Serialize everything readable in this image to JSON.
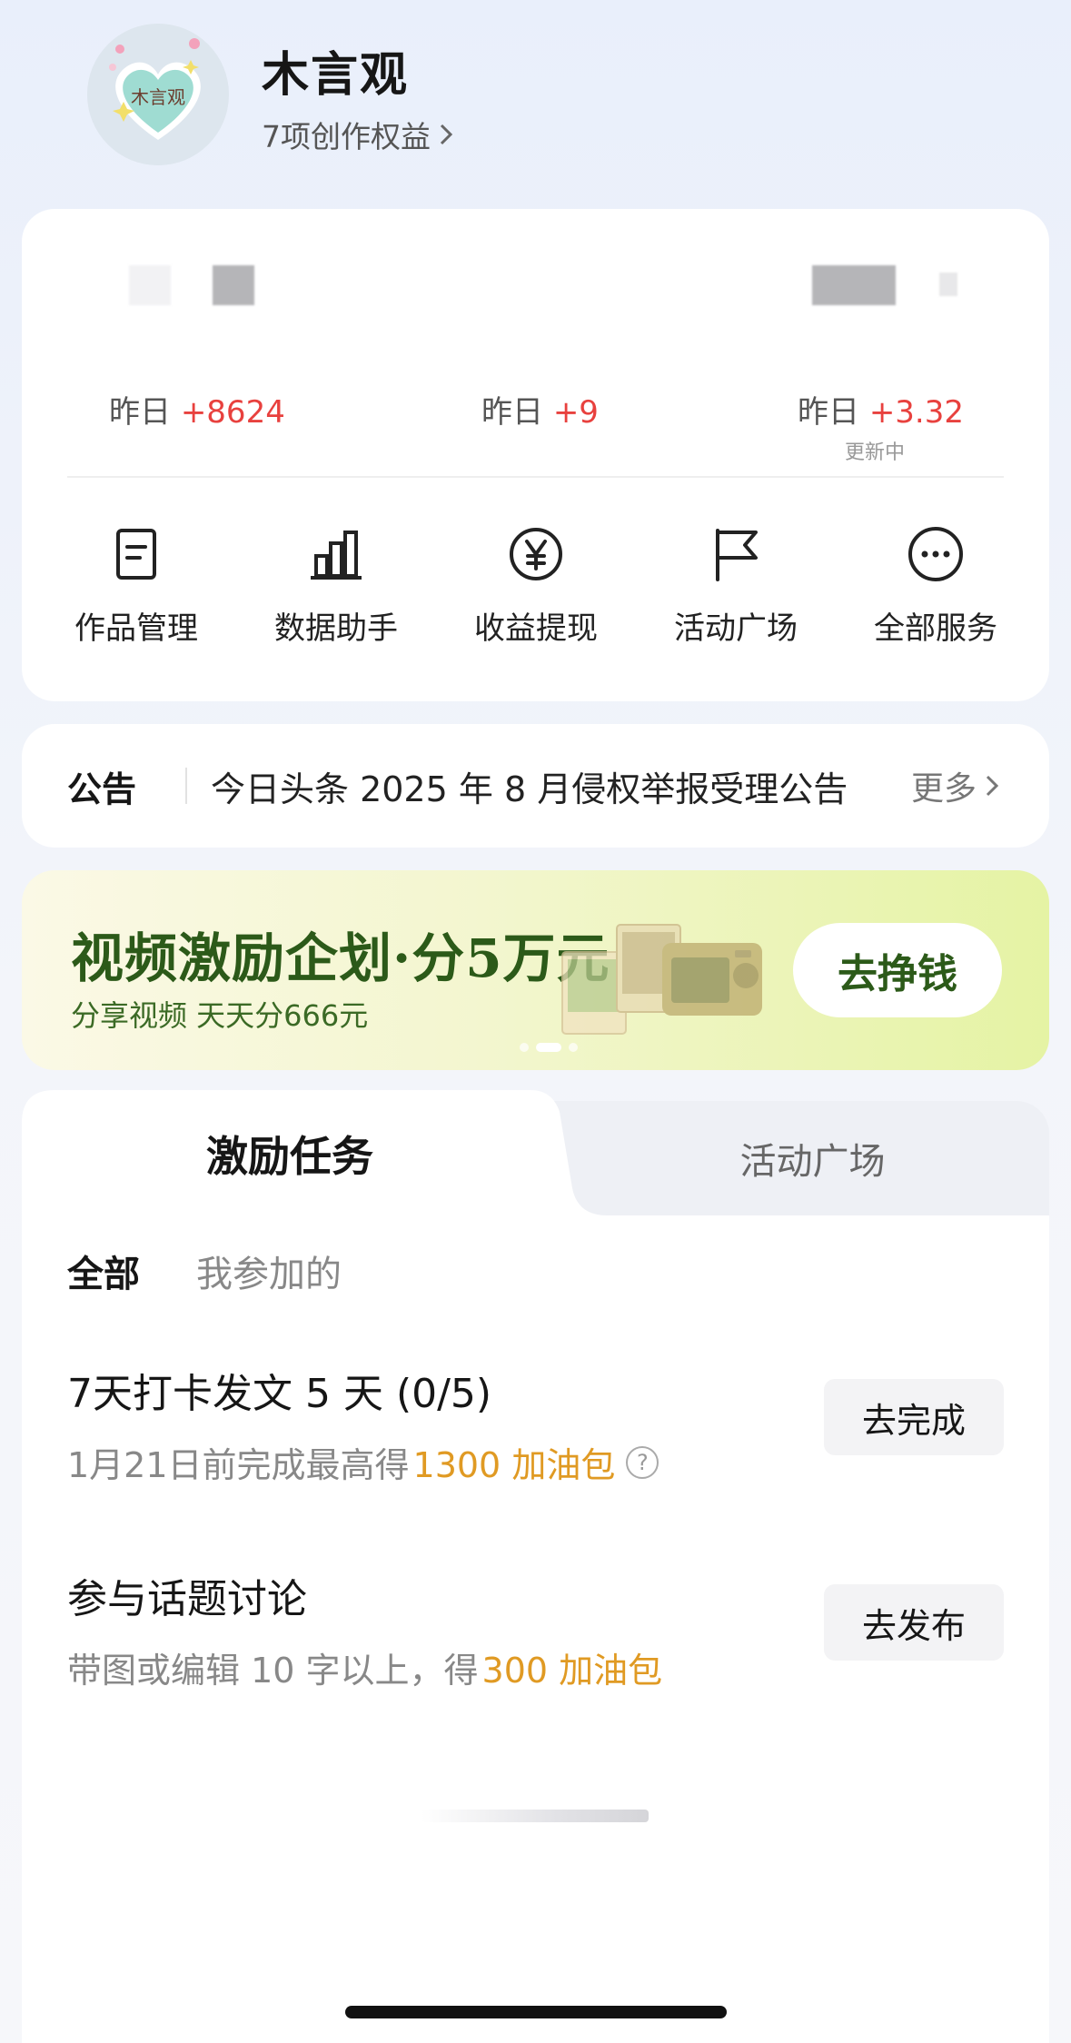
{
  "profile": {
    "name": "木言观",
    "rights_link": "7项创作权益",
    "avatar_text": "木言观"
  },
  "stats": [
    {
      "label": "昨日",
      "value": "+8624",
      "note": ""
    },
    {
      "label": "昨日",
      "value": "+9",
      "note": ""
    },
    {
      "label": "昨日",
      "value": "+3.32",
      "note": "更新中"
    }
  ],
  "services": [
    {
      "label": "作品管理",
      "icon": "document-icon"
    },
    {
      "label": "数据助手",
      "icon": "bar-chart-icon"
    },
    {
      "label": "收益提现",
      "icon": "yuan-icon"
    },
    {
      "label": "活动广场",
      "icon": "flag-icon"
    },
    {
      "label": "全部服务",
      "icon": "more-icon"
    }
  ],
  "notice": {
    "tag": "公告",
    "text": "今日头条 2025 年 8 月侵权举报受理公告",
    "more": "更多"
  },
  "banner": {
    "title": "视频激励企划·分5万元",
    "subtitle": "分享视频 天天分666元",
    "button": "去挣钱",
    "slides": 3,
    "active_slide": 2
  },
  "tasks": {
    "tabs": [
      "激励任务",
      "活动广场"
    ],
    "active_tab": 0,
    "filters": [
      "全部",
      "我参加的"
    ],
    "active_filter": 0,
    "items": [
      {
        "title": "7天打卡发文 5 天 (0/5)",
        "desc": "1月21日前完成最高得",
        "reward": "1300 加油包",
        "button": "去完成",
        "has_help": true
      },
      {
        "title": "参与话题讨论",
        "desc": "带图或编辑 10 字以上，得",
        "reward": "300 加油包",
        "button": "去发布",
        "has_help": false
      }
    ]
  },
  "colors": {
    "accent_red": "#e8413e",
    "reward_orange": "#e09a23",
    "banner_green": "#2c5a19"
  }
}
